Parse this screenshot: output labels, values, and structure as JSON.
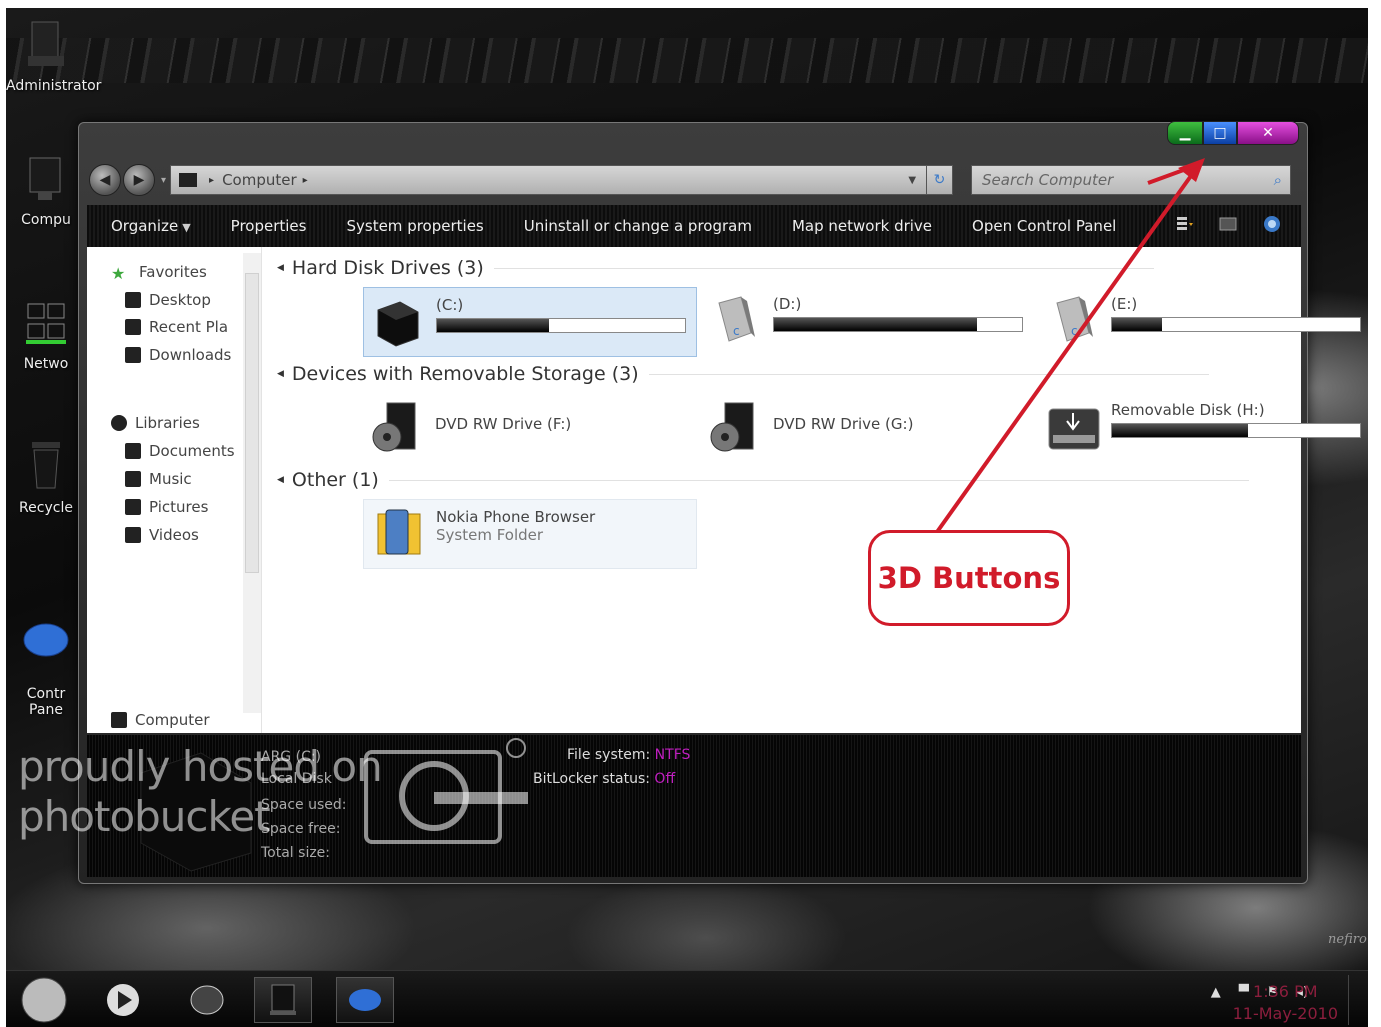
{
  "desktop": {
    "icons": [
      {
        "label": "Administrator"
      },
      {
        "label": "Compu"
      },
      {
        "label": "Netwo"
      },
      {
        "label": "Recycle"
      },
      {
        "label": "Contr\nPane"
      }
    ]
  },
  "window": {
    "address": {
      "location": "Computer"
    },
    "search": {
      "placeholder": "Search Computer"
    },
    "toolbar": {
      "items": [
        "Organize",
        "Properties",
        "System properties",
        "Uninstall or change a program",
        "Map network drive",
        "Open Control Panel"
      ]
    },
    "navpane": {
      "favorites": "Favorites",
      "fav_items": [
        "Desktop",
        "Recent Pla",
        "Downloads"
      ],
      "libraries": "Libraries",
      "lib_items": [
        "Documents",
        "Music",
        "Pictures",
        "Videos"
      ],
      "computer": "Computer"
    },
    "groups": {
      "hdd": "Hard Disk Drives (3)",
      "removable": "Devices with Removable Storage (3)",
      "other": "Other (1)"
    },
    "drives": {
      "c": {
        "label": "(C:)",
        "used": 0.45
      },
      "d": {
        "label": "(D:)",
        "used": 0.82
      },
      "e": {
        "label": "(E:)",
        "used": 0.2
      },
      "f": {
        "label": "DVD RW Drive (F:)"
      },
      "g": {
        "label": "DVD RW Drive (G:)"
      },
      "h": {
        "label": "Removable Disk (H:)",
        "used": 0.55
      }
    },
    "other_item": {
      "name": "Nokia Phone Browser",
      "type": "System Folder"
    },
    "details": {
      "drive_name": "ARG (C:)",
      "drive_type": "Local Disk",
      "space_used": "Space used:",
      "space_free": "Space free:",
      "total_size": "Total size:",
      "file_system_label": "File system:",
      "file_system": "NTFS",
      "bitlocker_label": "BitLocker status:",
      "bitlocker": "Off"
    }
  },
  "annotation": {
    "text": "3D Buttons",
    "color": "#d11b2a"
  },
  "watermark": {
    "line1": "proudly hosted on",
    "line2": "photobucket"
  },
  "taskbar": {
    "time": "1:36 PM",
    "date": "11-May-2010",
    "corner": "nefiro"
  },
  "colors": {
    "accent_magenta": "#c01fc0",
    "min_button": "#1f9b2f",
    "max_button": "#2a6bd8",
    "close_button": "#b51fb5"
  }
}
